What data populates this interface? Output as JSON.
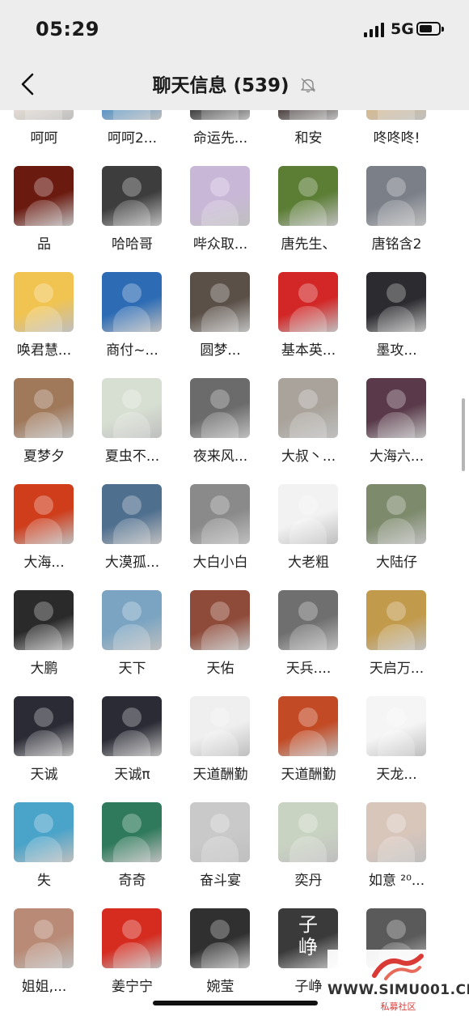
{
  "status_bar": {
    "time": "05:29",
    "network": "5G",
    "battery_level": 0.6
  },
  "header": {
    "back_icon": "chevron-left-icon",
    "title": "聊天信息 (539)",
    "mute_icon": "bell-muted-icon"
  },
  "members": [
    {
      "name": "呵呵",
      "avatar_color": "#e9dfd6"
    },
    {
      "name": "呵呵2...",
      "avatar_color": "#4b8fc7"
    },
    {
      "name": "命运先...",
      "avatar_color": "#2a2a2a"
    },
    {
      "name": "和安",
      "avatar_color": "#3c2f2f"
    },
    {
      "name": "咚咚咚!",
      "avatar_color": "#d8b98a"
    },
    {
      "name": "品",
      "avatar_color": "#6b1a10"
    },
    {
      "name": "哈哈哥",
      "avatar_color": "#3d3d3d"
    },
    {
      "name": "哔众取...",
      "avatar_color": "#c9b7d8"
    },
    {
      "name": "唐先生、",
      "avatar_color": "#5b7d34"
    },
    {
      "name": "唐铭含2",
      "avatar_color": "#7a7f88"
    },
    {
      "name": "唤君慧...",
      "avatar_color": "#f1c451"
    },
    {
      "name": "商付~...",
      "avatar_color": "#2d6cb5"
    },
    {
      "name": "圆梦...",
      "avatar_color": "#5b5048"
    },
    {
      "name": "基本英...",
      "avatar_color": "#d32626"
    },
    {
      "name": "墨攻...",
      "avatar_color": "#2b2b30"
    },
    {
      "name": "夏梦夕",
      "avatar_color": "#a0785a"
    },
    {
      "name": "夏虫不...",
      "avatar_color": "#d7dfd2"
    },
    {
      "name": "夜来风...",
      "avatar_color": "#6b6b6b"
    },
    {
      "name": "大叔丶...",
      "avatar_color": "#a9a39b"
    },
    {
      "name": "大海六...",
      "avatar_color": "#5a3a4a"
    },
    {
      "name": "大海...",
      "avatar_color": "#cf3d1b"
    },
    {
      "name": "大漠孤...",
      "avatar_color": "#4f6f8f"
    },
    {
      "name": "大白小白",
      "avatar_color": "#8a8a8a"
    },
    {
      "name": "大老粗",
      "avatar_color": "#f2f2f2"
    },
    {
      "name": "大陆仔",
      "avatar_color": "#7d8a6c"
    },
    {
      "name": "大鹏",
      "avatar_color": "#2a2a2a"
    },
    {
      "name": "天下",
      "avatar_color": "#7aa4c2"
    },
    {
      "name": "天佑",
      "avatar_color": "#8f4b3a"
    },
    {
      "name": "天兵....",
      "avatar_color": "#6f6f6f"
    },
    {
      "name": "天启万...",
      "avatar_color": "#c29a4c"
    },
    {
      "name": "天诚",
      "avatar_color": "#2b2b36"
    },
    {
      "name": "天诚π",
      "avatar_color": "#2b2b36"
    },
    {
      "name": "天道酬勤",
      "avatar_color": "#efefef"
    },
    {
      "name": "天道酬勤",
      "avatar_color": "#c24a24"
    },
    {
      "name": "天龙...",
      "avatar_color": "#f5f5f5"
    },
    {
      "name": "失",
      "avatar_color": "#4aa3c9"
    },
    {
      "name": "奇奇",
      "avatar_color": "#2f7a5c"
    },
    {
      "name": "奋斗宴",
      "avatar_color": "#c9c9c9"
    },
    {
      "name": "奕丹",
      "avatar_color": "#c9d3c2"
    },
    {
      "name": "如意 ²⁰...",
      "avatar_color": "#d9c6bb"
    },
    {
      "name": "姐姐,...",
      "avatar_color": "#b98b77"
    },
    {
      "name": "姜宁宁",
      "avatar_color": "#d62b1f"
    },
    {
      "name": "婉莹",
      "avatar_color": "#303030"
    },
    {
      "name": "子峥",
      "avatar_color": "#3a3a3a",
      "avatar_text": "子\n峥"
    },
    {
      "name": "",
      "avatar_color": "#5a5a5a"
    }
  ],
  "watermark": {
    "url": "WWW.SIMU001.CN",
    "caption": "私募社区",
    "brand_color": "#d93a36"
  }
}
